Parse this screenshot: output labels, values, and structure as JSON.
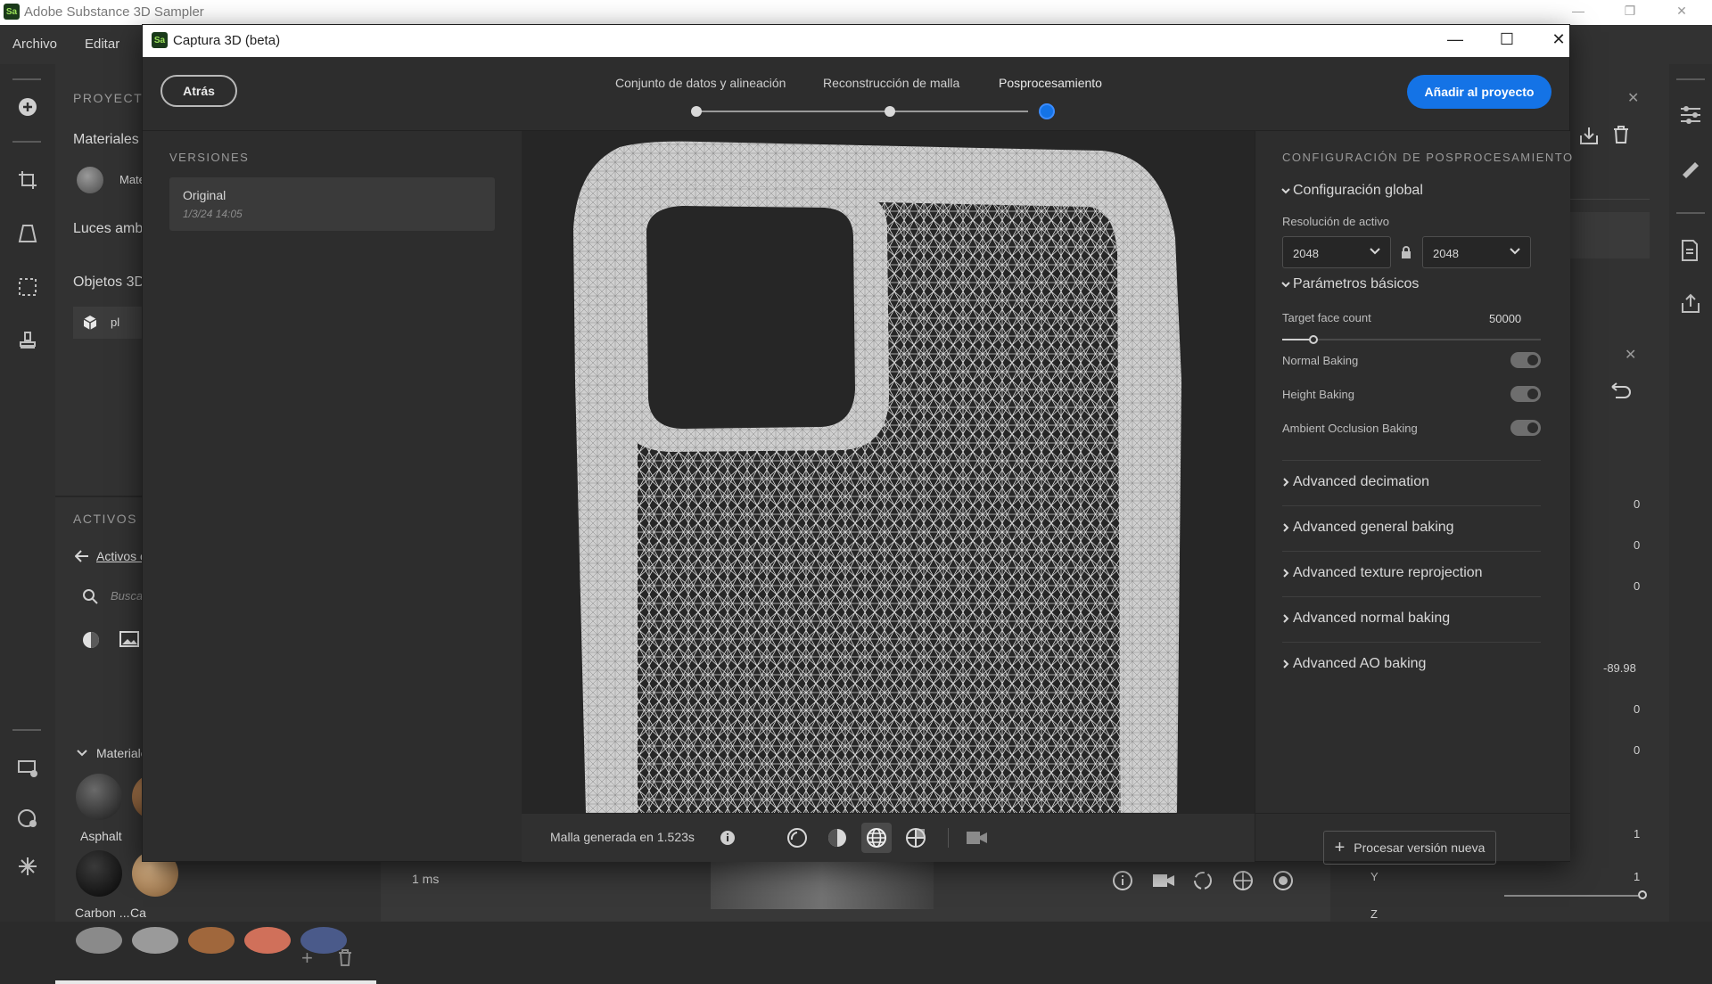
{
  "app": {
    "window_title": "Adobe Substance 3D Sampler",
    "logo_text": "Sa",
    "menu": [
      "Archivo",
      "Editar"
    ]
  },
  "left_panel": {
    "project_caption": "PROYECTO",
    "materials_label": "Materiales",
    "material_item": "Mate",
    "env_lights_label": "Luces amb",
    "objects_label": "Objetos 3D",
    "object_item": "pl",
    "assets_caption": "ACTIVOS",
    "assets_link": "Activos c",
    "search_placeholder": "Buscar",
    "materials_group": "Materiale",
    "material_names": [
      "Asphalt",
      "Carbon ...",
      "Ca"
    ]
  },
  "viewport_bar": {
    "timing": "1 ms"
  },
  "right_host": {
    "values": [
      "0",
      "0",
      "0",
      "-89.98",
      "0",
      "0",
      "1",
      "1"
    ],
    "y_label": "Y",
    "z_label": "Z"
  },
  "modal": {
    "title": "Captura 3D (beta)",
    "back_label": "Atrás",
    "steps": [
      "Conjunto de datos y alineación",
      "Reconstrucción de malla",
      "Posprocesamiento"
    ],
    "active_step": 2,
    "add_to_project_label": "Añadir al proyecto",
    "versions": {
      "caption": "VERSIONES",
      "items": [
        {
          "name": "Original",
          "date": "1/3/24 14:05"
        }
      ]
    },
    "viewport": {
      "status": "Malla generada en 1.523s",
      "active_mode": "wireframe"
    },
    "settings": {
      "caption": "CONFIGURACIÓN DE POSPROCESAMIENTO",
      "global_section": "Configuración global",
      "resolution_label": "Resolución de activo",
      "resolution_w": "2048",
      "resolution_h": "2048",
      "basic_section": "Parámetros básicos",
      "target_face_label": "Target face count",
      "target_face_value": "50000",
      "target_face_fraction": 0.12,
      "toggles": [
        {
          "label": "Normal Baking",
          "on": true
        },
        {
          "label": "Height Baking",
          "on": true
        },
        {
          "label": "Ambient Occlusion Baking",
          "on": true
        }
      ],
      "advanced": [
        "Advanced decimation",
        "Advanced general baking",
        "Advanced texture reprojection",
        "Advanced normal baking",
        "Advanced AO baking"
      ],
      "process_button": "Procesar versión nueva"
    }
  },
  "colors": {
    "accent": "#1473e6",
    "panel": "#2d2d2d",
    "viewport_bg": "#262626",
    "mesh": "#d8d8d8"
  }
}
